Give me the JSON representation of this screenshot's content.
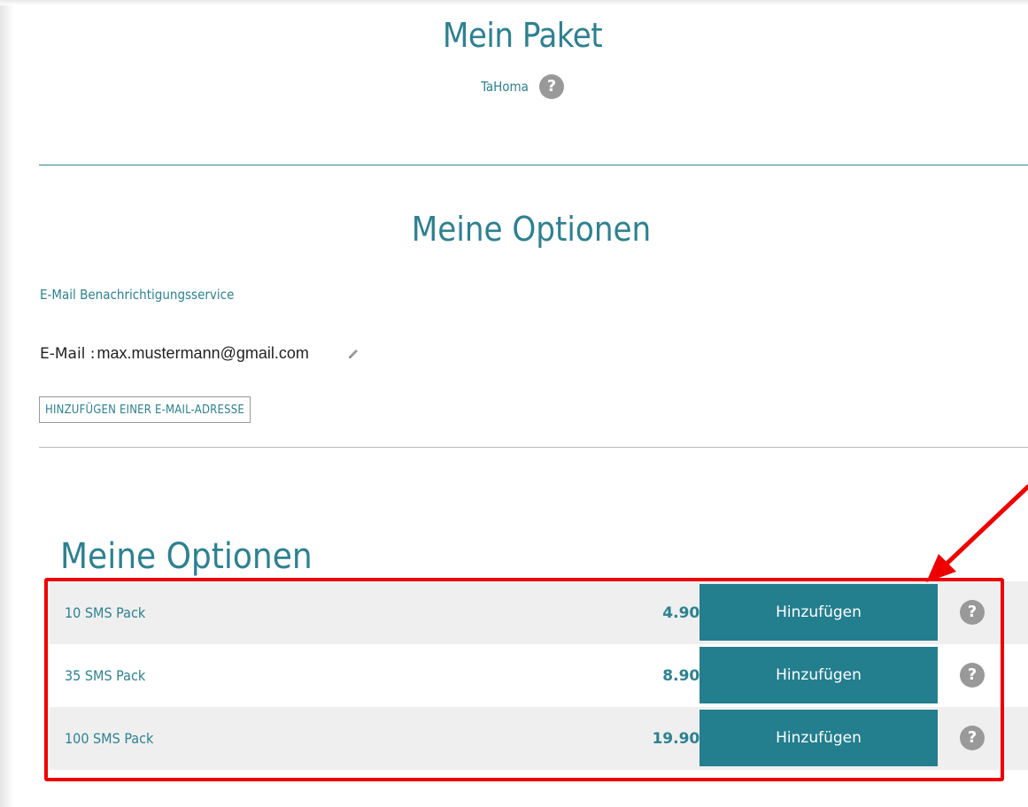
{
  "package": {
    "title": "Mein Paket",
    "subtitle": "TaHoma",
    "help_icon": "?"
  },
  "email_section": {
    "title": "Meine Optionen",
    "service_label": "E-Mail Benachrichtigungsservice",
    "email_label": "E-Mail : ",
    "email_value": "max.mustermann@gmail.com",
    "add_button_label": "HINZUFÜGEN EINER E-MAIL-ADRESSE"
  },
  "options_section": {
    "title": "Meine Optionen",
    "items": [
      {
        "name": "10 SMS Pack",
        "price": "4.90 €",
        "button_label": "Hinzufügen",
        "help_icon": "?"
      },
      {
        "name": "35 SMS Pack",
        "price": "8.90 €",
        "button_label": "Hinzufügen",
        "help_icon": "?"
      },
      {
        "name": "100 SMS Pack",
        "price": "19.90 €",
        "button_label": "Hinzufügen",
        "help_icon": "?"
      }
    ]
  },
  "colors": {
    "accent": "#2d8191",
    "button": "#237e8e",
    "annotation": "#ee0000",
    "help_icon": "#999999",
    "row_shade": "#efefef"
  },
  "icons": {
    "help": "question-circle-icon",
    "edit": "pencil-icon",
    "annotation_arrow": "arrow-icon"
  }
}
